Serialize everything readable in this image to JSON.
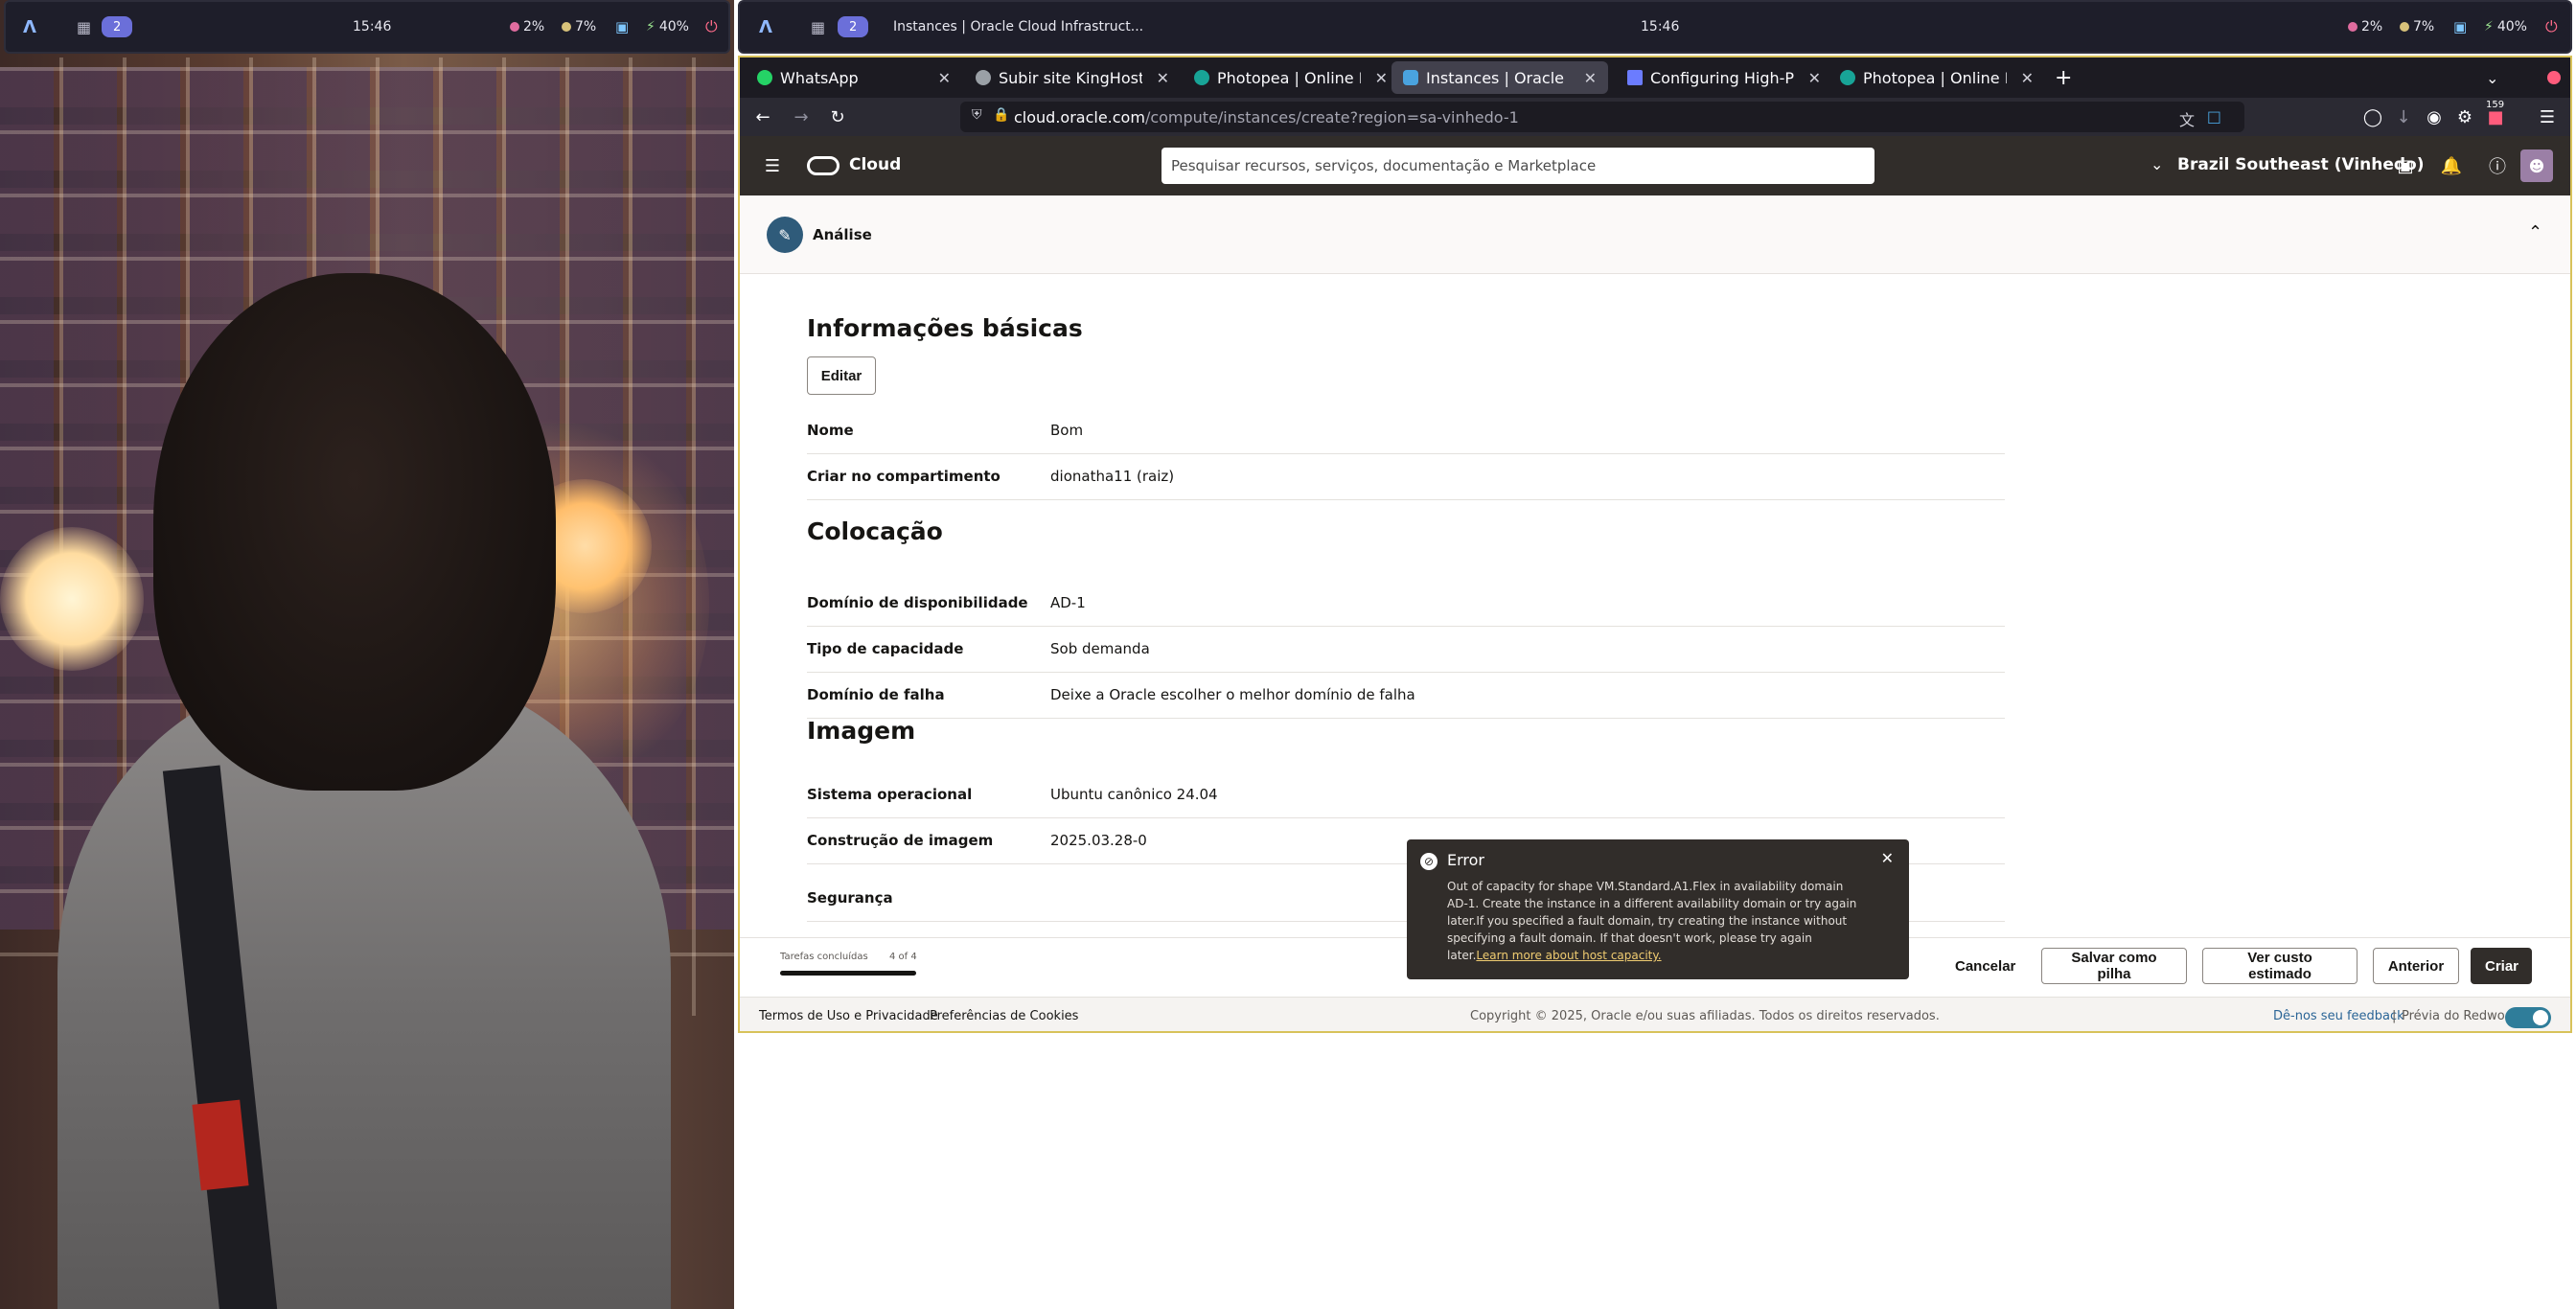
{
  "desktop": {
    "left_bar": {
      "time": "15:46",
      "workspace": "2",
      "cpu": "2%",
      "mem": "7%",
      "battery": "40%"
    },
    "right_bar": {
      "time": "15:46",
      "workspace": "2",
      "window_title": "Instances | Oracle Cloud Infrastruct...",
      "cpu": "2%",
      "mem": "7%",
      "battery": "40%"
    }
  },
  "browser": {
    "tabs": [
      {
        "label": "WhatsApp",
        "color": "#25d366",
        "active": false
      },
      {
        "label": "Subir site KingHost",
        "color": "#9aa0a6",
        "active": false
      },
      {
        "label": "Photopea | Online Photo",
        "color": "#18a497",
        "active": false
      },
      {
        "label": "Instances | Oracle Cloud",
        "color": "#4aa3df",
        "active": true
      },
      {
        "label": "Configuring High-Perfor",
        "color": "#6b7cff",
        "active": false
      },
      {
        "label": "Photopea | Online Photo",
        "color": "#18a497",
        "active": false
      }
    ],
    "url_host": "cloud.oracle.com",
    "url_path": "/compute/instances/create?region=sa-vinhedo-1",
    "downloads_badge": "159"
  },
  "oci": {
    "logo_text": "Cloud",
    "search_placeholder": "Pesquisar recursos, serviços, documentação e Marketplace",
    "region": "Brazil Southeast (Vinhedo)",
    "section_title": "Análise"
  },
  "review": {
    "basic_title": "Informações básicas",
    "edit_label": "Editar",
    "basic_rows": [
      {
        "key": "Nome",
        "value": "Bom"
      },
      {
        "key": "Criar no compartimento",
        "value": "dionatha11 (raiz)"
      }
    ],
    "placement_title": "Colocação",
    "placement_rows": [
      {
        "key": "Domínio de disponibilidade",
        "value": "AD-1"
      },
      {
        "key": "Tipo de capacidade",
        "value": "Sob demanda"
      },
      {
        "key": "Domínio de falha",
        "value": "Deixe a Oracle escolher o melhor domínio de falha"
      }
    ],
    "image_title": "Imagem",
    "image_rows": [
      {
        "key": "Sistema operacional",
        "value": "Ubuntu canônico 24.04"
      },
      {
        "key": "Construção de imagem",
        "value": "2025.03.28-0"
      }
    ],
    "security_label": "Segurança"
  },
  "actions": {
    "progress_label": "Tarefas concluídas",
    "progress_count": "4 of 4",
    "progress_fraction": 1.0,
    "cancel": "Cancelar",
    "save_stack": "Salvar como pilha",
    "estimate": "Ver custo estimado",
    "previous": "Anterior",
    "create": "Criar"
  },
  "footer": {
    "terms": "Termos de Uso e Privacidade",
    "cookies": "Preferências de Cookies",
    "copyright": "Copyright © 2025, Oracle e/ou suas afiliadas. Todos os direitos reservados.",
    "feedback": "Dê-nos seu feedback",
    "redwood": "Prévia do Redwood"
  },
  "toast": {
    "title": "Error",
    "message": "Out of capacity for shape VM.Standard.A1.Flex in availability domain AD-1. Create the instance in a different availability domain or try again later.If you specified a fault domain, try creating the instance without specifying a fault domain. If that doesn't work, please try again later.",
    "link": "Learn more about host capacity."
  }
}
